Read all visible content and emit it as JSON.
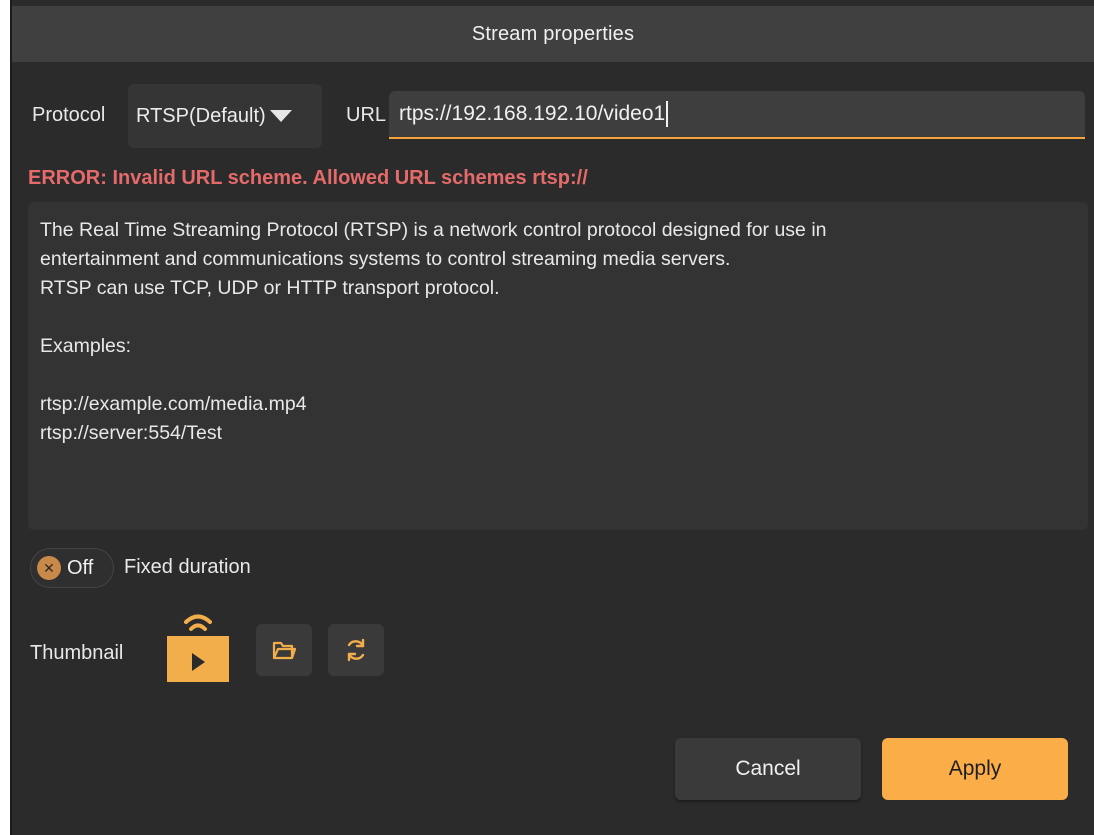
{
  "window": {
    "title": "Stream properties"
  },
  "protocol": {
    "label": "Protocol",
    "selected": "RTSP(Default)"
  },
  "url": {
    "label": "URL",
    "value": "rtps://192.168.192.10/video1"
  },
  "error": {
    "message": "ERROR: Invalid URL scheme. Allowed URL schemes rtsp://"
  },
  "info": {
    "lines": [
      "The Real Time Streaming Protocol (RTSP) is a network control protocol designed for use in",
      "entertainment and communications systems to control streaming media servers.",
      "RTSP can use TCP, UDP or HTTP transport protocol.",
      "",
      "Examples:",
      "",
      "rtsp://example.com/media.mp4",
      "rtsp://server:554/Test"
    ]
  },
  "fixed_duration": {
    "toggle_state": "Off",
    "label": "Fixed duration"
  },
  "thumbnail": {
    "label": "Thumbnail",
    "preview_icon": "stream-play-icon",
    "buttons": [
      "folder-open-icon",
      "refresh-icon"
    ]
  },
  "actions": {
    "cancel_label": "Cancel",
    "apply_label": "Apply"
  },
  "colors": {
    "accent": "#fbae47",
    "error": "#e56a6a",
    "background": "#2b2b2b"
  }
}
